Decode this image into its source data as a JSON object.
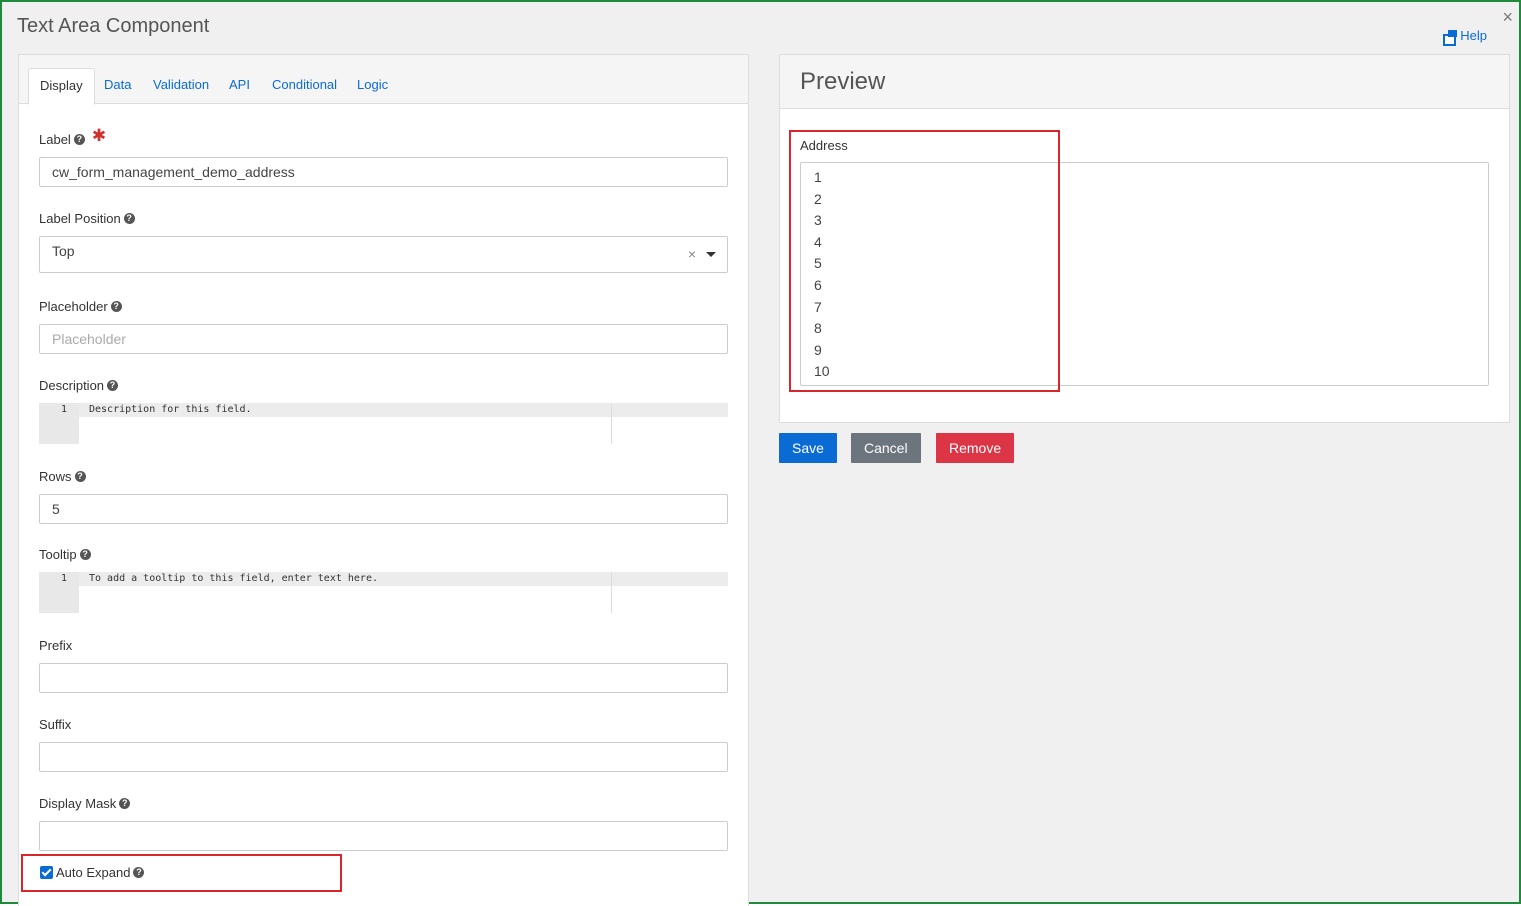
{
  "dialog": {
    "title": "Text Area Component",
    "help_label": "Help",
    "close_glyph": "×"
  },
  "tabs": [
    {
      "label": "Display",
      "active": true
    },
    {
      "label": "Data",
      "active": false
    },
    {
      "label": "Validation",
      "active": false
    },
    {
      "label": "API",
      "active": false
    },
    {
      "label": "Conditional",
      "active": false
    },
    {
      "label": "Logic",
      "active": false
    }
  ],
  "form": {
    "label": {
      "label": "Label",
      "value": "cw_form_management_demo_address",
      "required_mark": "✱"
    },
    "label_position": {
      "label": "Label Position",
      "value": "Top",
      "clear_glyph": "×"
    },
    "placeholder": {
      "label": "Placeholder",
      "placeholder": "Placeholder"
    },
    "description": {
      "label": "Description",
      "line_number": "1",
      "code": "Description for this field."
    },
    "rows": {
      "label": "Rows",
      "value": "5"
    },
    "tooltip": {
      "label": "Tooltip",
      "line_number": "1",
      "code": "To add a tooltip to this field, enter text here."
    },
    "prefix": {
      "label": "Prefix",
      "value": ""
    },
    "suffix": {
      "label": "Suffix",
      "value": ""
    },
    "display_mask": {
      "label": "Display Mask",
      "value": ""
    },
    "auto_expand": {
      "label": "Auto Expand",
      "checked": true
    }
  },
  "preview": {
    "title": "Preview",
    "field_label": "Address",
    "lines": [
      "1",
      "2",
      "3",
      "4",
      "5",
      "6",
      "7",
      "8",
      "9",
      "10"
    ]
  },
  "actions": {
    "save": "Save",
    "cancel": "Cancel",
    "remove": "Remove"
  },
  "icons": {
    "help": "external-window-icon",
    "question": "question-circle-icon",
    "close": "close-icon",
    "dropdown": "caret-down-icon"
  },
  "colors": {
    "link": "#0b6bd4",
    "highlight": "#d9262c",
    "frame": "#1e8a3c",
    "remove": "#dc3545",
    "cancel": "#6c757d"
  }
}
